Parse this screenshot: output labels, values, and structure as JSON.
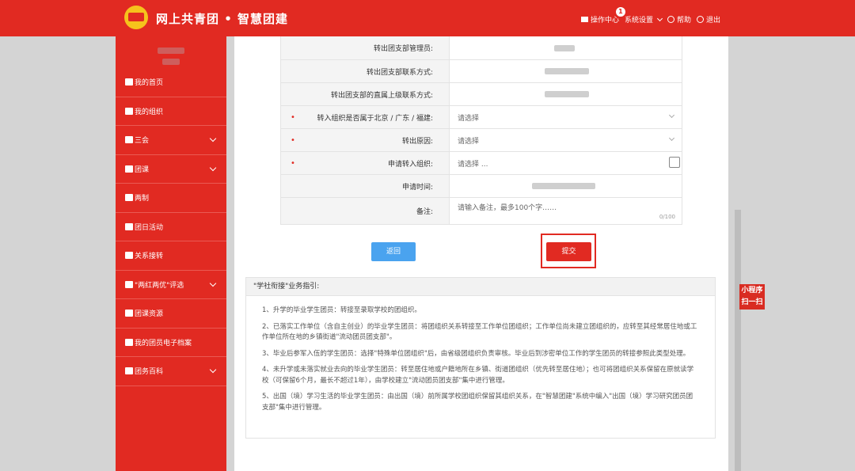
{
  "header": {
    "brand": "网上共青团 • 智慧团建",
    "nav": {
      "ops_center": "操作中心",
      "ops_badge": "1",
      "settings": "系统设置",
      "help": "帮助",
      "logout": "退出"
    }
  },
  "sidebar": {
    "items": [
      {
        "label": "我的首页",
        "icon": "home-icon",
        "has_submenu": false
      },
      {
        "label": "我的组织",
        "icon": "users-icon",
        "has_submenu": false
      },
      {
        "label": "三会",
        "icon": "edit-icon",
        "has_submenu": true
      },
      {
        "label": "团课",
        "icon": "folder-icon",
        "has_submenu": true
      },
      {
        "label": "两制",
        "icon": "circle-icon",
        "has_submenu": false
      },
      {
        "label": "团日活动",
        "icon": "recycle-icon",
        "has_submenu": false
      },
      {
        "label": "关系接转",
        "icon": "refresh-icon",
        "has_submenu": false
      },
      {
        "label": "\"两红两优\"评选",
        "icon": "edit-icon",
        "has_submenu": true
      },
      {
        "label": "团课资源",
        "icon": "folder-icon",
        "has_submenu": false
      },
      {
        "label": "我的团员电子档案",
        "icon": "file-icon",
        "has_submenu": false
      },
      {
        "label": "团务百科",
        "icon": "users-icon",
        "has_submenu": true
      }
    ]
  },
  "form": {
    "rows": [
      {
        "label": "转出团支部管理员:",
        "required": false,
        "value": ""
      },
      {
        "label": "转出团支部联系方式:",
        "required": false,
        "value": ""
      },
      {
        "label": "转出团支部的直属上级联系方式:",
        "required": false,
        "value": ""
      },
      {
        "label": "转入组织是否属于北京 / 广东 / 福建:",
        "required": true,
        "placeholder": "请选择"
      },
      {
        "label": "转出原因:",
        "required": true,
        "placeholder": "请选择"
      },
      {
        "label": "申请转入组织:",
        "required": true,
        "placeholder": "请选择 ..."
      },
      {
        "label": "申请时间:",
        "required": false,
        "value": ""
      },
      {
        "label": "备注:",
        "required": false,
        "placeholder": "请输入备注，最多100个字……",
        "counter": "0/100"
      }
    ],
    "back_label": "返回",
    "submit_label": "提交"
  },
  "guide": {
    "title": "\"学社衔接\"业务指引:",
    "paragraphs": [
      "1、升学的毕业学生团员：转接至录取学校的团组织。",
      "2、已落实工作单位（含自主创业）的毕业学生团员：将团组织关系转接至工作单位团组织；工作单位尚未建立团组织的，应转至其经常居住地或工作单位所在地的乡镇街道\"流动团员团支部\"。",
      "3、毕业后参军入伍的学生团员：选择\"特殊单位团组织\"后，由省级团组织负责审核。毕业后到涉密单位工作的学生团员的转接参照此类型处理。",
      "4、未升学或未落实就业去向的毕业学生团员：转至居住地或户籍地所在乡镇、街道团组织（优先转至居住地）；也可将团组织关系保留在原就读学校（可保留6个月，最长不超过1年），由学校建立\"流动团员团支部\"集中进行管理。",
      "5、出国（境）学习生活的毕业学生团员：由出国（境）前所属学校团组织保留其组织关系，在\"智慧团建\"系统中编入\"出国（境）学习研究团员团支部\"集中进行管理。"
    ]
  },
  "miniapp": {
    "label": "小程序扫一扫"
  }
}
